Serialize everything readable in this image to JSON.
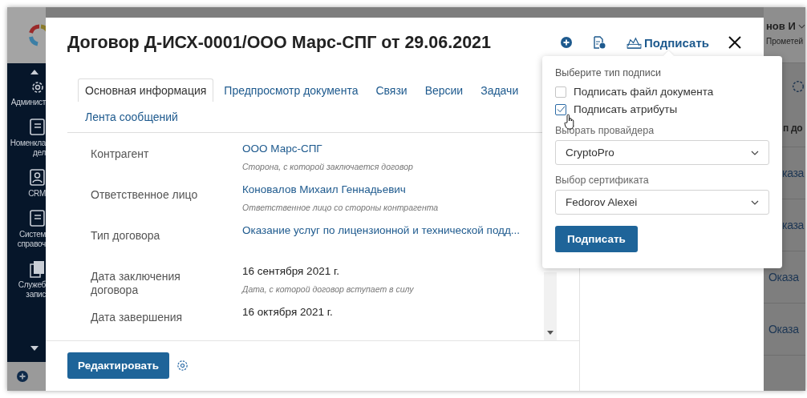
{
  "background": {
    "sidebar_items": [
      {
        "kind": "gear",
        "lines": [
          "Админист"
        ]
      },
      {
        "kind": "book",
        "lines": [
          "Номенкла",
          "дел"
        ]
      },
      {
        "kind": "contact",
        "lines": [
          "CRM"
        ]
      },
      {
        "kind": "book",
        "lines": [
          "Систем",
          "справоч"
        ]
      },
      {
        "kind": "pages",
        "lines": [
          "Служеб",
          "запис"
        ]
      }
    ],
    "user": {
      "name": "нов И",
      "org": "Прометей"
    },
    "panel": {
      "heading": "п до",
      "rows": [
        "каза",
        "каза",
        "Оказа",
        "Оказа"
      ]
    }
  },
  "dialog": {
    "title": "Договор Д-ИСХ-0001/ООО Марс-СПГ от 29.06.2021",
    "sign_action": "Подписать",
    "tabs": [
      {
        "label": "Основная информация",
        "selected": true
      },
      {
        "label": "Предпросмотр документа",
        "selected": false
      },
      {
        "label": "Связи",
        "selected": false
      },
      {
        "label": "Версии",
        "selected": false
      },
      {
        "label": "Задачи",
        "selected": false
      },
      {
        "label": "Лента сообщений",
        "selected": false
      }
    ],
    "fields": [
      {
        "label": "Контрагент",
        "kind": "link",
        "value": "ООО Марс-СПГ",
        "hint": "Сторона, с которой заключается договор"
      },
      {
        "label": "Ответственное лицо",
        "kind": "link",
        "value": "Коновалов Михаил Геннадьевич",
        "hint": "Ответственное лицо со стороны контрагента"
      },
      {
        "label": "Тип договора",
        "kind": "link",
        "value": "Оказание услуг по лицензионной и технической подд..."
      },
      {
        "label": "Дата заключения договора",
        "kind": "text",
        "value": "16 сентября 2021 г.",
        "hint": "Дата, с которой договор вступает в силу"
      },
      {
        "label": "Дата завершения",
        "kind": "text",
        "value": "16 октября 2021 г."
      }
    ],
    "edit_button": "Редактировать"
  },
  "sign_popover": {
    "title": "Выберите тип подписи",
    "options": [
      {
        "label": "Подписать файл документа",
        "checked": false
      },
      {
        "label": "Подписать атрибуты",
        "checked": true
      }
    ],
    "provider": {
      "label": "Выбрать провайдера",
      "value": "CryptoPro"
    },
    "certificate": {
      "label": "Выбор сертификата",
      "value": "Fedorov Alexei"
    },
    "button": "Подписать"
  }
}
